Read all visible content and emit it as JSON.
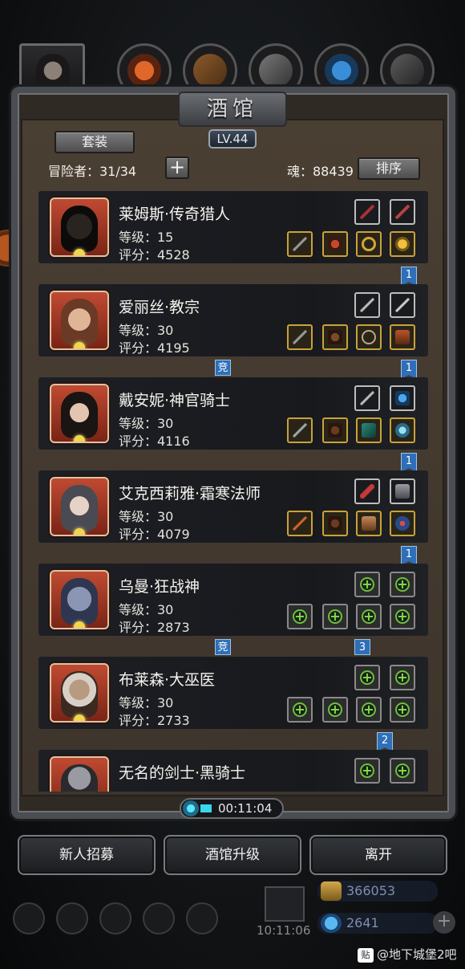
{
  "header": {
    "title": "酒馆",
    "level": "LV.44",
    "suit_label": "套装",
    "adventurers_label": "冒险者：31/34",
    "add_label": "+",
    "soul_label": "魂：88439",
    "sort_label": "排序"
  },
  "heroes": [
    {
      "name": "莱姆斯·传奇猎人",
      "level": "等级：15",
      "score": "评分：4528"
    },
    {
      "name": "爱丽丝·教宗",
      "level": "等级：30",
      "score": "评分：4195"
    },
    {
      "name": "戴安妮·神官骑士",
      "level": "等级：30",
      "score": "评分：4116"
    },
    {
      "name": "艾克西莉雅·霜寒法师",
      "level": "等级：30",
      "score": "评分：4079"
    },
    {
      "name": "乌曼·狂战神",
      "level": "等级：30",
      "score": "评分：2873"
    },
    {
      "name": "布莱森·大巫医",
      "level": "等级：30",
      "score": "评分：2733"
    },
    {
      "name": "无名的剑士·黑骑士",
      "level": "",
      "score": ""
    }
  ],
  "tags": {
    "ribbon": "1",
    "arena": "竞",
    "three": "3",
    "two": "2"
  },
  "timer": "00:11:04",
  "buttons": {
    "recruit": "新人招募",
    "upgrade": "酒馆升级",
    "leave": "离开"
  },
  "resources": {
    "gold": "366053",
    "gems": "2641"
  },
  "clock": "10:11:06",
  "watermark": {
    "icon": "贴",
    "text": "@地下城堡2吧"
  },
  "colors": {
    "accent_blue": "#2e6fb8",
    "gold_border": "#c9a23a",
    "plus_green": "#66c23a"
  }
}
